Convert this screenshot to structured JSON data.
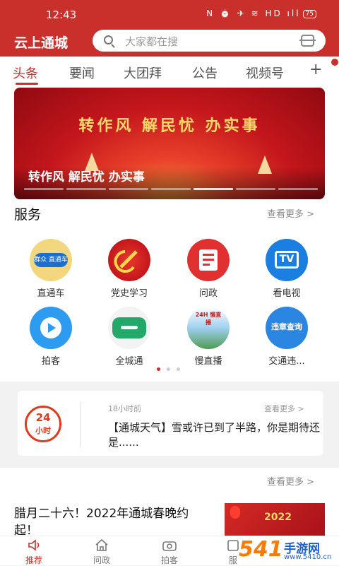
{
  "status_bar": {
    "time": "12:43",
    "icons": "N ⏰ ✈ ≋ HD ıll",
    "battery": "75"
  },
  "header": {
    "app_title": "云上通城",
    "search_placeholder": "大家都在搜"
  },
  "tabs": [
    {
      "label": "头条",
      "active": true
    },
    {
      "label": "要闻",
      "active": false
    },
    {
      "label": "大团拜",
      "active": false
    },
    {
      "label": "公告",
      "active": false
    },
    {
      "label": "视频号",
      "active": false
    }
  ],
  "tab_add": "+",
  "banner": {
    "slogan": "转作风  解民忧  办实事",
    "caption": "转作风 解民忧 办实事",
    "slides_total": 7,
    "slides_current": 5
  },
  "services": {
    "title": "服务",
    "more": "查看更多 >",
    "items": [
      {
        "label": "直通车",
        "icon": "zhitongche-icon",
        "icon_text": "群众 直通车"
      },
      {
        "label": "党史学习",
        "icon": "party-emblem-icon",
        "icon_text": ""
      },
      {
        "label": "问政",
        "icon": "wenzheng-icon",
        "icon_text": ""
      },
      {
        "label": "看电视",
        "icon": "tv-icon",
        "icon_text": "TV"
      },
      {
        "label": "拍客",
        "icon": "paike-icon",
        "icon_text": ""
      },
      {
        "label": "全城通",
        "icon": "quanchengtong-icon",
        "icon_text": ""
      },
      {
        "label": "慢直播",
        "icon": "slow-live-icon",
        "icon_text": "24H 慢直播"
      },
      {
        "label": "交通违...",
        "icon": "traffic-violation-icon",
        "icon_text": "违章查询"
      }
    ],
    "page_count": 3,
    "page_current": 1
  },
  "news_card": {
    "badge_top": "24",
    "badge_bottom": "小时",
    "time": "18小时前",
    "more": "查看更多 >",
    "text": "【通城天气】雪或许已到了半路，你是期待还是......"
  },
  "news_section": {
    "more": "查看更多 >",
    "headline": "腊月二十六！2022年通城春晚约起！",
    "image_text": "2022"
  },
  "bottom_nav": [
    {
      "label": "推荐",
      "icon": "speaker-icon",
      "active": true
    },
    {
      "label": "问政",
      "icon": "home-icon",
      "active": false
    },
    {
      "label": "拍客",
      "icon": "camera-icon",
      "active": false
    },
    {
      "label": "服",
      "icon": "service-icon",
      "active": false
    }
  ],
  "watermark": {
    "main": "手游网",
    "domain": "www.5410.cn",
    "num": "541"
  },
  "colors": {
    "brand_red": "#c9302c",
    "gold": "#ffd76a"
  }
}
